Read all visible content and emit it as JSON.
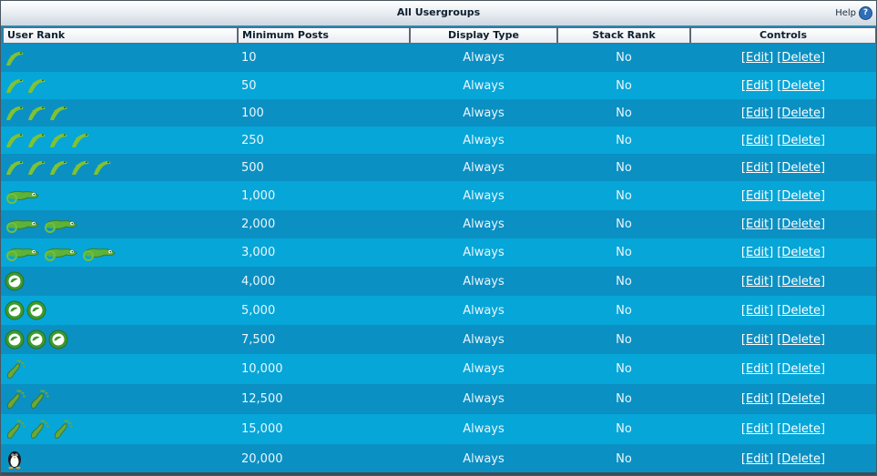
{
  "panel": {
    "title": "All Usergroups",
    "help_label": "Help",
    "help_icon": "question-icon"
  },
  "columns": [
    "User Rank",
    "Minimum Posts",
    "Display Type",
    "Stack Rank",
    "Controls"
  ],
  "controls": {
    "edit": "[Edit]",
    "delete": "[Delete]"
  },
  "rows": [
    {
      "icon": "lizard-icon",
      "count": 1,
      "min_posts": "10",
      "display": "Always",
      "stack": "No"
    },
    {
      "icon": "lizard-icon",
      "count": 2,
      "min_posts": "50",
      "display": "Always",
      "stack": "No"
    },
    {
      "icon": "lizard-icon",
      "count": 3,
      "min_posts": "100",
      "display": "Always",
      "stack": "No"
    },
    {
      "icon": "lizard-icon",
      "count": 4,
      "min_posts": "250",
      "display": "Always",
      "stack": "No"
    },
    {
      "icon": "lizard-icon",
      "count": 5,
      "min_posts": "500",
      "display": "Always",
      "stack": "No"
    },
    {
      "icon": "chameleon-icon",
      "count": 1,
      "min_posts": "1,000",
      "display": "Always",
      "stack": "No"
    },
    {
      "icon": "chameleon-icon",
      "count": 2,
      "min_posts": "2,000",
      "display": "Always",
      "stack": "No"
    },
    {
      "icon": "chameleon-icon",
      "count": 3,
      "min_posts": "3,000",
      "display": "Always",
      "stack": "No"
    },
    {
      "icon": "badge-icon",
      "count": 1,
      "min_posts": "4,000",
      "display": "Always",
      "stack": "No"
    },
    {
      "icon": "badge-icon",
      "count": 2,
      "min_posts": "5,000",
      "display": "Always",
      "stack": "No"
    },
    {
      "icon": "badge-icon",
      "count": 3,
      "min_posts": "7,500",
      "display": "Always",
      "stack": "No"
    },
    {
      "icon": "footprint-icon",
      "count": 1,
      "min_posts": "10,000",
      "display": "Always",
      "stack": "No"
    },
    {
      "icon": "footprint-icon",
      "count": 2,
      "min_posts": "12,500",
      "display": "Always",
      "stack": "No"
    },
    {
      "icon": "footprint-icon",
      "count": 3,
      "min_posts": "15,000",
      "display": "Always",
      "stack": "No"
    },
    {
      "icon": "penguin-icon",
      "count": 1,
      "min_posts": "20,000",
      "display": "Always",
      "stack": "No"
    }
  ]
}
